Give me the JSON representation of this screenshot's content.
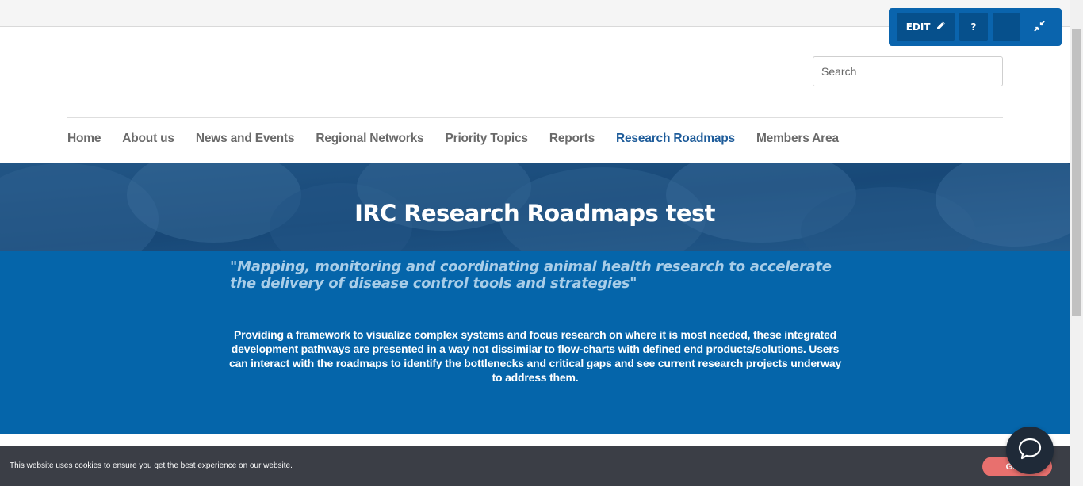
{
  "toolbar": {
    "edit_label": "EDIT",
    "help_label": "?",
    "icons": [
      "pencil-icon",
      "question-icon",
      "blank",
      "collapse-arrows-icon"
    ]
  },
  "search": {
    "placeholder": "Search",
    "value": ""
  },
  "nav": {
    "items": [
      {
        "label": "Home",
        "active": false
      },
      {
        "label": "About us",
        "active": false
      },
      {
        "label": "News and Events",
        "active": false
      },
      {
        "label": "Regional Networks",
        "active": false
      },
      {
        "label": "Priority Topics",
        "active": false
      },
      {
        "label": "Reports",
        "active": false
      },
      {
        "label": "Research Roadmaps",
        "active": true
      },
      {
        "label": "Members Area",
        "active": false
      }
    ]
  },
  "banner": {
    "title": "IRC Research Roadmaps test"
  },
  "hero": {
    "quote": "\"Mapping, monitoring and coordinating animal health research to accelerate the delivery of disease control tools and strategies\"",
    "description": "Providing a framework to visualize complex systems and focus research on where it is most needed, these integrated development pathways are presented in a way not dissimilar to flow-charts with defined end products/solutions. Users can interact with the roadmaps to identify the bottlenecks and critical gaps and see current research projects underway to address them."
  },
  "cookie": {
    "text": "This website uses cookies to ensure you get the best experience on our website.",
    "button_label": "Got it"
  },
  "colors": {
    "toolbar_bg": "#0a64ad",
    "hero_bg": "#0565aa",
    "nav_active": "#1e5c9a",
    "cookie_bg": "#3b3e46",
    "cookie_button": "#e8706e"
  }
}
